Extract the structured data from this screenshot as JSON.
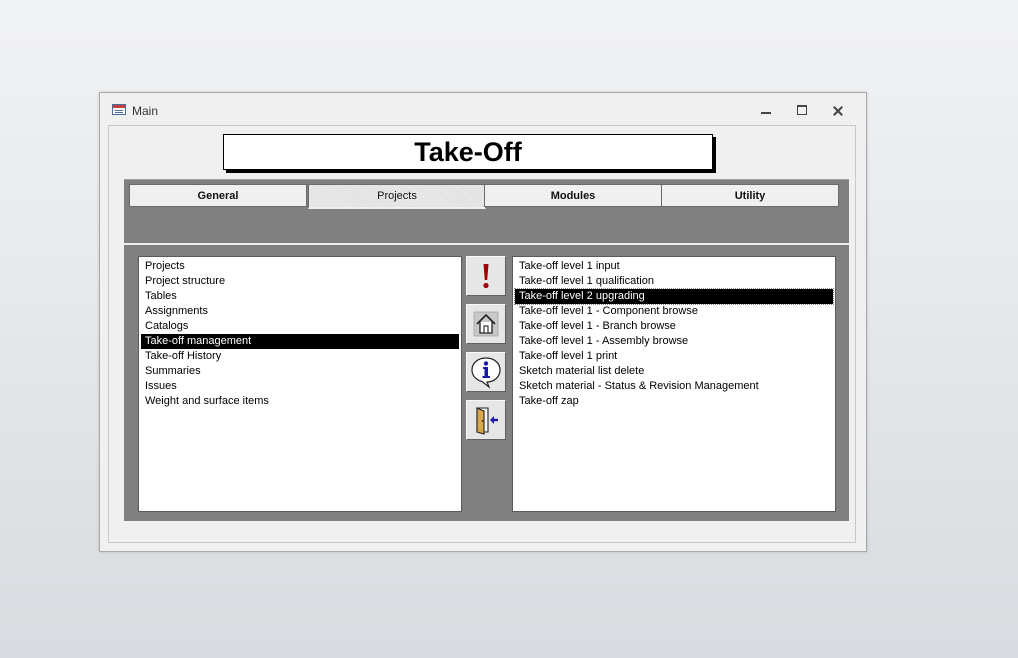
{
  "window": {
    "title": "Main"
  },
  "header": {
    "title": "Take-Off"
  },
  "tabs": [
    {
      "label": "General"
    },
    {
      "label": "Projects",
      "active": true
    },
    {
      "label": "Modules"
    },
    {
      "label": "Utility"
    }
  ],
  "left_list": {
    "items": [
      "Projects",
      "Project structure",
      "Tables",
      "Assignments",
      "Catalogs",
      "Take-off management",
      "Take-off History",
      "Summaries",
      "Issues",
      "Weight and surface items"
    ],
    "selected": "Take-off management"
  },
  "right_list": {
    "items": [
      "Take-off level 1 input",
      "Take-off level 1 qualification",
      "Take-off level 2 upgrading",
      "Take-off level 1 - Component browse",
      "Take-off level 1 - Branch browse",
      "Take-off level 1 - Assembly browse",
      "Take-off level 1 print",
      "Sketch material list delete",
      "Sketch material - Status & Revision Management",
      "Take-off zap"
    ],
    "selected": "Take-off level 2 upgrading"
  },
  "side_buttons": [
    {
      "icon": "exclamation-icon"
    },
    {
      "icon": "home-icon"
    },
    {
      "icon": "info-icon"
    },
    {
      "icon": "exit-door-icon"
    }
  ],
  "colors": {
    "panel": "#808080",
    "selection": "#000000",
    "exclamation": "#a00000",
    "info": "#1a1aa8"
  }
}
